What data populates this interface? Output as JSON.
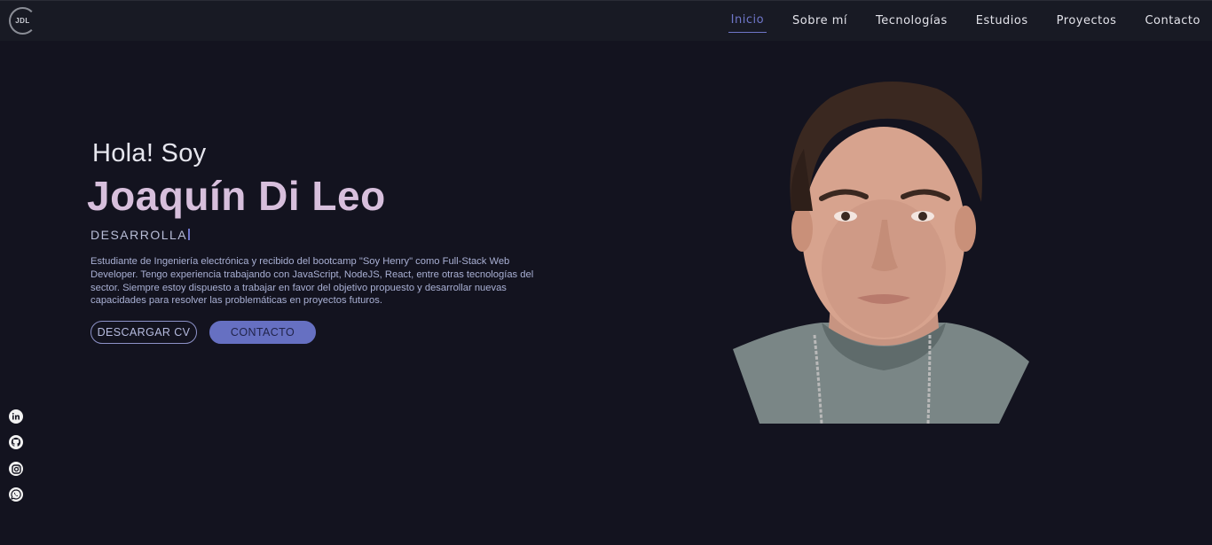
{
  "header": {
    "logo_text": "JDL",
    "nav": [
      {
        "label": "Inicio",
        "active": true
      },
      {
        "label": "Sobre mí",
        "active": false
      },
      {
        "label": "Tecnologías",
        "active": false
      },
      {
        "label": "Estudios",
        "active": false
      },
      {
        "label": "Proyectos",
        "active": false
      },
      {
        "label": "Contacto",
        "active": false
      }
    ]
  },
  "hero": {
    "greeting": "Hola! Soy",
    "name": "Joaquín Di Leo",
    "typed_text": "DESARROLLA",
    "description": "Estudiante de Ingeniería electrónica y recibido del bootcamp \"Soy Henry\" como Full-Stack Web Developer. Tengo experiencia trabajando con JavaScript, NodeJS, React, entre otras tecnologías del sector. Siempre estoy dispuesto a trabajar en favor del objetivo propuesto y desarrollar nuevas capacidades para resolver las problemáticas en proyectos futuros.",
    "cv_button": "DESCARGAR CV",
    "contact_button": "CONTACTO"
  },
  "social": [
    "linkedin-icon",
    "github-icon",
    "instagram-icon",
    "whatsapp-icon"
  ],
  "colors": {
    "background": "#13131f",
    "header": "#181a24",
    "accent": "#6670c2",
    "name": "#d7bfdc"
  }
}
